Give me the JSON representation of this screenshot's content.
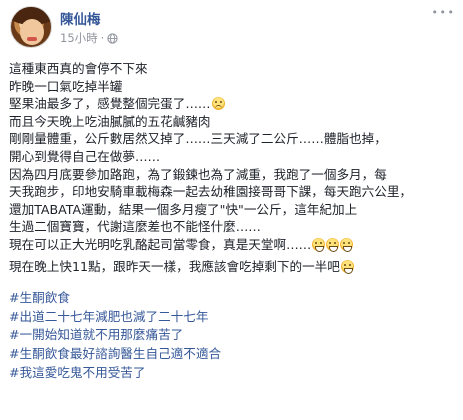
{
  "post": {
    "author": "陳仙梅",
    "time": "15小時",
    "separator": "·",
    "more": "• • •"
  },
  "lines": [
    "這種東西真的會停不下來",
    "昨晚一口氣吃掉半罐",
    "堅果油最多了，感覺整個完蛋了……",
    "而且今天晚上吃油膩膩的五花鹹豬肉",
    "剛剛量體重，公斤數居然又掉了……三天減了二公斤……體脂也掉，",
    "開心到覺得自己在做夢……",
    "因為四月底要參加路跑，為了鍛鍊也為了減重，我跑了一個多月，每",
    "天我跑步，印地安騎車載梅森一起去幼稚園接哥哥下課，每天跑六公里，",
    "還加TABATA運動，結果一個多月瘦了\"快\"一公斤，這年紀加上",
    "生過二個寶寶，代謝這麼差也不能怪什麼……",
    "現在可以正大光明吃乳酪起司當零食，真是天堂啊……",
    "現在晚上快11點，跟昨天一樣，我應該會吃掉剩下的一半吧"
  ],
  "hashtags": [
    "#生酮飲食",
    "#出道二十七年減肥也減了二十七年",
    "#一開始知道就不用那麼痛苦了",
    "#生酮飲食最好諮詢醫生自己適不適合",
    "#我這愛吃鬼不用受苦了"
  ],
  "icons": {
    "globe": "globe-icon",
    "more": "more-icon",
    "emoji_sad": "sad-face-emoji",
    "emoji_grin": "grinning-face-emoji",
    "emoji_smile": "smiling-face-emoji"
  },
  "colors": {
    "link": "#365899",
    "text": "#1d2129",
    "meta": "#90949c"
  }
}
